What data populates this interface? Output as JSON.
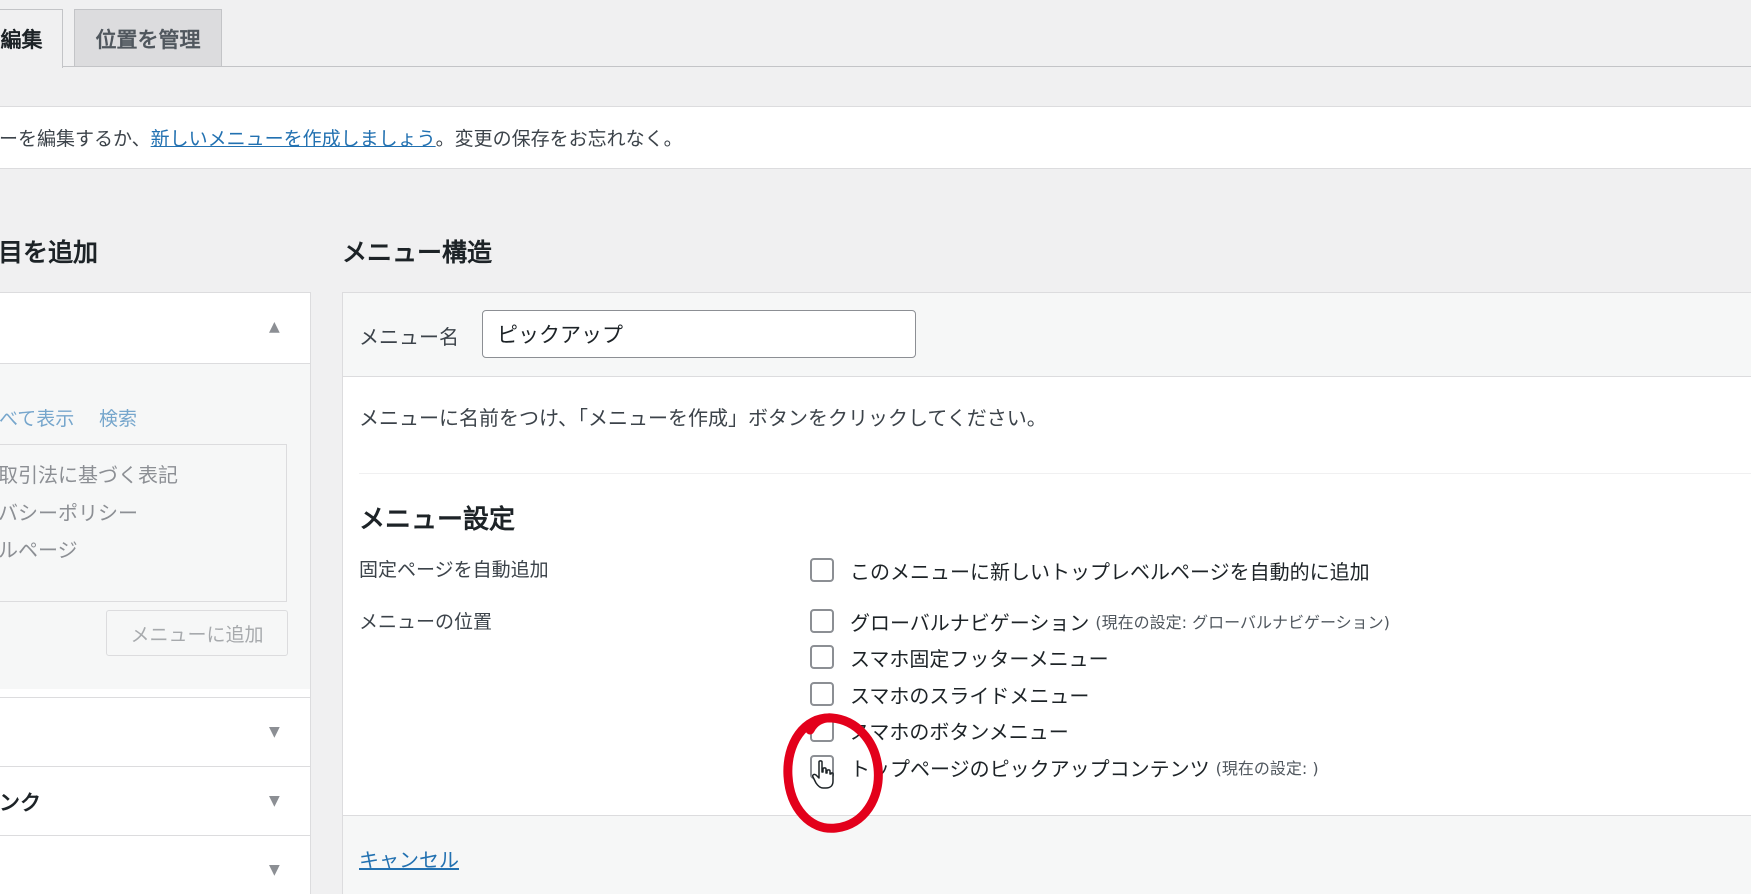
{
  "tabs": {
    "edit_label": "編集",
    "manage_label": "位置を管理"
  },
  "notice": {
    "text_before": "ーを編集するか、",
    "link_text": "新しいメニューを作成しましょう",
    "text_after": "。変更の保存をお忘れなく。"
  },
  "left": {
    "title": "目を追加",
    "tab_view_all": "べて表示",
    "tab_search": "検索",
    "items": [
      "取引法に基づく表記",
      "バシーポリシー",
      "ルページ"
    ],
    "add_button_label": "メニューに追加",
    "sections": [
      "",
      "ンク",
      ""
    ]
  },
  "right": {
    "title": "メニュー構造",
    "name_label": "メニュー名",
    "name_value": "ピックアップ",
    "instruction": "メニューに名前をつけ、「メニューを作成」ボタンをクリックしてください。",
    "settings_title": "メニュー設定",
    "auto_add_label": "固定ページを自動追加",
    "auto_add_option": "このメニューに新しいトップレベルページを自動的に追加",
    "location_label": "メニューの位置",
    "locations": [
      {
        "label": "グローバルナビゲーション",
        "note": "(現在の設定: グローバルナビゲーション)",
        "checked": false
      },
      {
        "label": "スマホ固定フッターメニュー",
        "note": "",
        "checked": false
      },
      {
        "label": "スマホのスライドメニュー",
        "note": "",
        "checked": false
      },
      {
        "label": "スマホのボタンメニュー",
        "note": "",
        "checked": false
      },
      {
        "label": "トップページのピックアップコンテンツ",
        "note": "(現在の設定: )",
        "checked": false
      }
    ],
    "cancel_label": "キャンセル"
  },
  "colors": {
    "link": "#2271b1",
    "annotation": "#e3001b",
    "background": "#f0f0f1"
  }
}
